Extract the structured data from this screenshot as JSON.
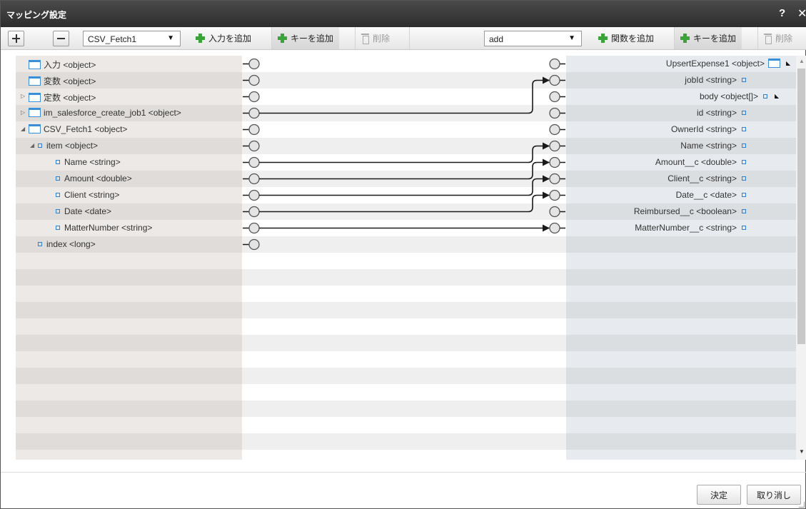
{
  "dialog": {
    "title": "マッピング設定",
    "help": "?",
    "close": "✕"
  },
  "toolbar": {
    "source_select": "CSV_Fetch1",
    "add_input": "入力を追加",
    "add_key_left": "キーを追加",
    "delete_left": "削除",
    "function_select": "add",
    "add_function": "関数を追加",
    "add_key_right": "キーを追加",
    "delete_right": "削除"
  },
  "left_items": [
    {
      "label": "入力 <object>",
      "icon": "object-icon",
      "depth": 0,
      "expander": ""
    },
    {
      "label": "変数 <object>",
      "icon": "object-icon",
      "depth": 0,
      "expander": ""
    },
    {
      "label": "定数 <object>",
      "icon": "object-icon",
      "depth": 0,
      "expander": "collapsed"
    },
    {
      "label": "im_salesforce_create_job1 <object>",
      "icon": "object-icon",
      "depth": 0,
      "expander": "collapsed"
    },
    {
      "label": "CSV_Fetch1 <object>",
      "icon": "object-icon",
      "depth": 0,
      "expander": "expanded"
    },
    {
      "label": "item <object>",
      "icon": "field-icon",
      "depth": 1,
      "expander": "expanded"
    },
    {
      "label": "Name <string>",
      "icon": "field-icon",
      "depth": 2,
      "expander": ""
    },
    {
      "label": "Amount <double>",
      "icon": "field-icon",
      "depth": 2,
      "expander": ""
    },
    {
      "label": "Client <string>",
      "icon": "field-icon",
      "depth": 2,
      "expander": ""
    },
    {
      "label": "Date <date>",
      "icon": "field-icon",
      "depth": 2,
      "expander": ""
    },
    {
      "label": "MatterNumber <string>",
      "icon": "field-icon",
      "depth": 2,
      "expander": ""
    },
    {
      "label": "index <long>",
      "icon": "field-icon",
      "depth": 1,
      "expander": ""
    }
  ],
  "right_items": [
    {
      "label": "UpsertExpense1 <object>",
      "icon": "object-icon",
      "expander": "expanded"
    },
    {
      "label": "jobId <string>",
      "icon": "field-icon",
      "expander": ""
    },
    {
      "label": "body <object[]>",
      "icon": "field-icon",
      "expander": "expanded"
    },
    {
      "label": "id <string>",
      "icon": "field-icon",
      "expander": ""
    },
    {
      "label": "OwnerId <string>",
      "icon": "field-icon",
      "expander": ""
    },
    {
      "label": "Name <string>",
      "icon": "field-icon",
      "expander": ""
    },
    {
      "label": "Amount__c <double>",
      "icon": "field-icon",
      "expander": ""
    },
    {
      "label": "Client__c <string>",
      "icon": "field-icon",
      "expander": ""
    },
    {
      "label": "Date__c <date>",
      "icon": "field-icon",
      "expander": ""
    },
    {
      "label": "Reimbursed__c <boolean>",
      "icon": "field-icon",
      "expander": ""
    },
    {
      "label": "MatterNumber__c <string>",
      "icon": "field-icon",
      "expander": ""
    }
  ],
  "mappings": [
    {
      "from": "im_salesforce_create_job1 <object>",
      "to": "jobId <string>"
    },
    {
      "from": "Name <string>",
      "to": "Name <string>"
    },
    {
      "from": "Amount <double>",
      "to": "Amount__c <double>"
    },
    {
      "from": "Client <string>",
      "to": "Client__c <string>"
    },
    {
      "from": "Date <date>",
      "to": "Date__c <date>"
    },
    {
      "from": "MatterNumber <string>",
      "to": "MatterNumber__c <string>"
    }
  ],
  "footer": {
    "ok": "決定",
    "cancel": "取り消し"
  },
  "colors": {
    "wire": "#1a1a1a",
    "left_bg": "#ece9e6",
    "right_bg": "#e7ebef",
    "title_bar": "#3a3a3a",
    "add_icon": "#3aa33a",
    "object_icon": "#3a8fd8"
  }
}
